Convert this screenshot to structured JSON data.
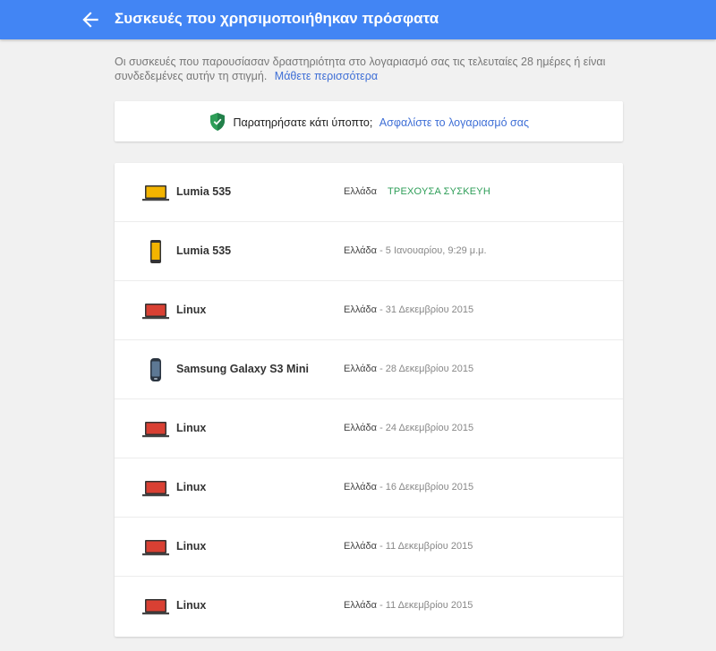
{
  "header": {
    "title": "Συσκευές που χρησιμοποιήθηκαν πρόσφατα",
    "back_icon": "arrow-back-icon"
  },
  "intro": {
    "text": "Οι συσκευές που παρουσίασαν δραστηριότητα στο λογαριασμό σας τις τελευταίες 28 ημέρες ή είναι συνδεδεμένες αυτήν τη στιγμή.",
    "link": "Μάθετε περισσότερα"
  },
  "alert": {
    "icon": "shield-check-icon",
    "text": "Παρατηρήσατε κάτι ύποπτο;",
    "link": "Ασφαλίστε το λογαριασμό σας"
  },
  "colors": {
    "header": "#4285f4",
    "link": "#3f6fd6",
    "current": "#2e9e58",
    "shield": "#2e9e58"
  },
  "devices": [
    {
      "name": "Lumia 535",
      "type": "laptop-yellow-icon",
      "country": "Ελλάδα",
      "date": "",
      "current": "ΤΡΕΧΟΥΣΑ ΣΥΣΚΕΥΗ"
    },
    {
      "name": "Lumia 535",
      "type": "phone-yellow-icon",
      "country": "Ελλάδα",
      "date": " - 5 Ιανουαρίου, 9:29 μ.μ.",
      "current": ""
    },
    {
      "name": "Linux",
      "type": "laptop-red-icon",
      "country": "Ελλάδα",
      "date": " - 31 Δεκεμβρίου 2015",
      "current": ""
    },
    {
      "name": "Samsung Galaxy S3 Mini",
      "type": "phone-samsung-icon",
      "country": "Ελλάδα",
      "date": " - 28 Δεκεμβρίου 2015",
      "current": ""
    },
    {
      "name": "Linux",
      "type": "laptop-red-icon",
      "country": "Ελλάδα",
      "date": " - 24 Δεκεμβρίου 2015",
      "current": ""
    },
    {
      "name": "Linux",
      "type": "laptop-red-icon",
      "country": "Ελλάδα",
      "date": " - 16 Δεκεμβρίου 2015",
      "current": ""
    },
    {
      "name": "Linux",
      "type": "laptop-red-icon",
      "country": "Ελλάδα",
      "date": " - 11 Δεκεμβρίου 2015",
      "current": ""
    },
    {
      "name": "Linux",
      "type": "laptop-red-icon",
      "country": "Ελλάδα",
      "date": " - 11 Δεκεμβρίου 2015",
      "current": ""
    }
  ]
}
